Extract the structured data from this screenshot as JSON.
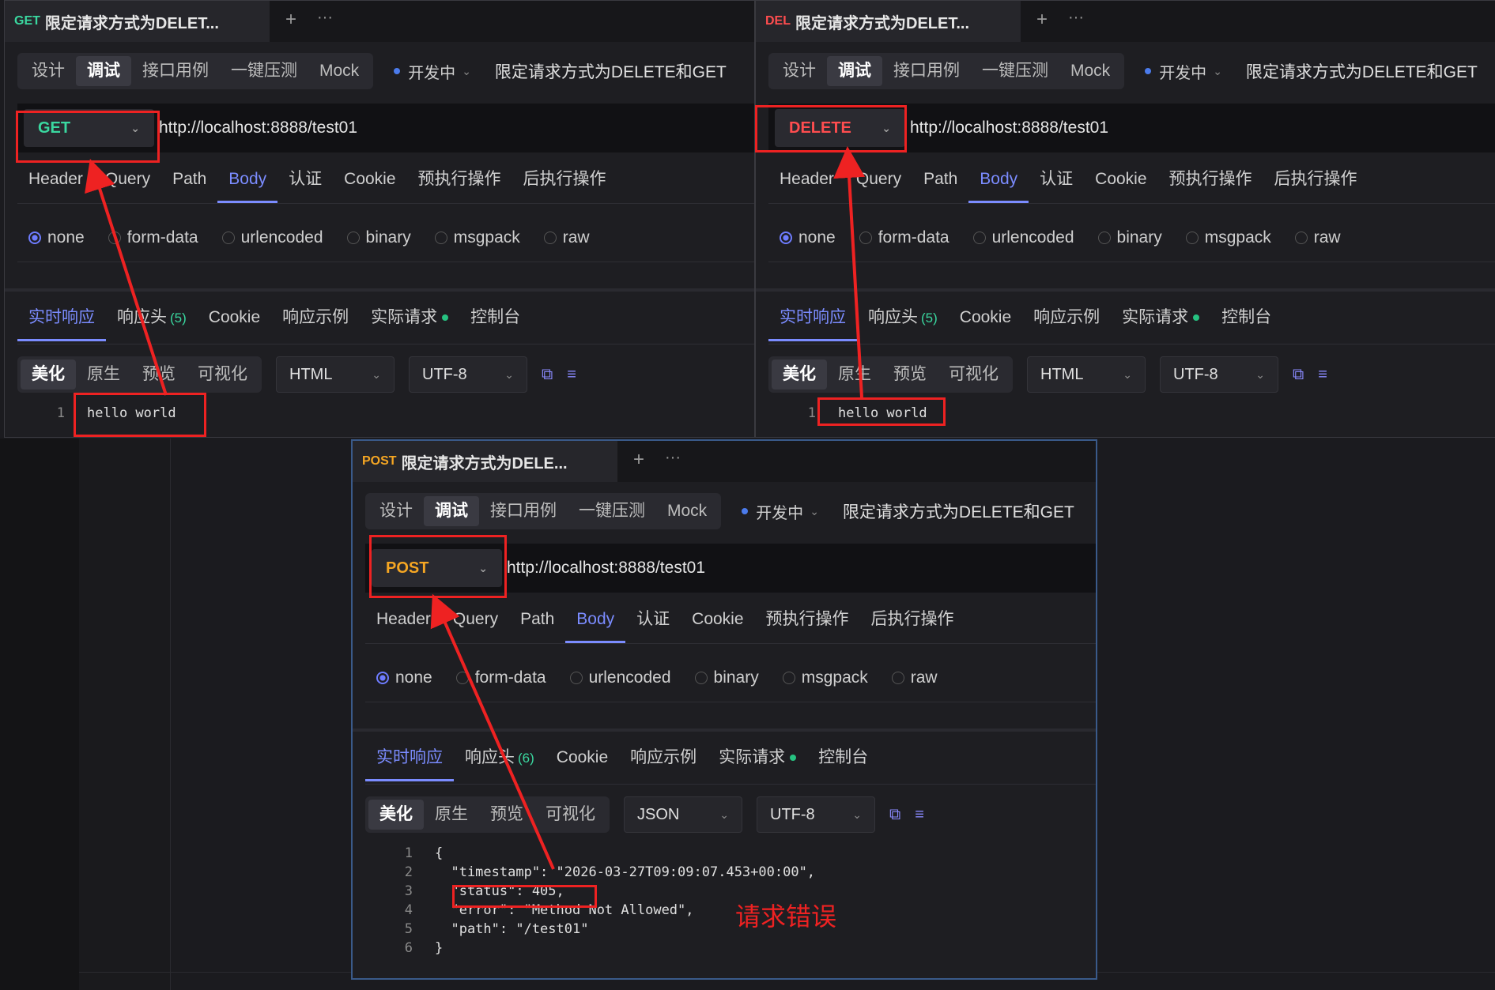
{
  "panels": [
    {
      "tab": {
        "method_tag": "GET",
        "method_color": "#3ad8a0",
        "title": "限定请求方式为DELET..."
      },
      "modes": [
        "设计",
        "调试",
        "接口用例",
        "一键压测",
        "Mock"
      ],
      "active_mode": "调试",
      "status": "开发中",
      "description": "限定请求方式为DELETE和GET",
      "method": "GET",
      "method_color": "#3ad8a0",
      "url": "http://localhost:8888/test01",
      "request_tabs": [
        "Header",
        "Query",
        "Path",
        "Body",
        "认证",
        "Cookie",
        "预执行操作",
        "后执行操作"
      ],
      "active_request_tab": "Body",
      "body_types": [
        "none",
        "form-data",
        "urlencoded",
        "binary",
        "msgpack",
        "raw"
      ],
      "selected_body_type": "none",
      "response_tabs": [
        "实时响应",
        "响应头",
        "Cookie",
        "响应示例",
        "实际请求",
        "控制台"
      ],
      "response_header_count": "(5)",
      "formats": [
        "美化",
        "原生",
        "预览",
        "可视化"
      ],
      "active_format": "美化",
      "content_type": "HTML",
      "encoding": "UTF-8",
      "code_lines": [
        {
          "no": "1",
          "text": "hello world"
        }
      ]
    },
    {
      "tab": {
        "method_tag": "DEL",
        "method_color": "#ff4d4f",
        "title": "限定请求方式为DELET..."
      },
      "modes": [
        "设计",
        "调试",
        "接口用例",
        "一键压测",
        "Mock"
      ],
      "active_mode": "调试",
      "status": "开发中",
      "description": "限定请求方式为DELETE和GET",
      "method": "DELETE",
      "method_color": "#ff4d4f",
      "url": "http://localhost:8888/test01",
      "request_tabs": [
        "Header",
        "Query",
        "Path",
        "Body",
        "认证",
        "Cookie",
        "预执行操作",
        "后执行操作"
      ],
      "active_request_tab": "Body",
      "body_types": [
        "none",
        "form-data",
        "urlencoded",
        "binary",
        "msgpack",
        "raw"
      ],
      "selected_body_type": "none",
      "response_tabs": [
        "实时响应",
        "响应头",
        "Cookie",
        "响应示例",
        "实际请求",
        "控制台"
      ],
      "response_header_count": "(5)",
      "formats": [
        "美化",
        "原生",
        "预览",
        "可视化"
      ],
      "active_format": "美化",
      "content_type": "HTML",
      "encoding": "UTF-8",
      "code_lines": [
        {
          "no": "1",
          "text": "hello world"
        }
      ]
    },
    {
      "tab": {
        "method_tag": "POST",
        "method_color": "#f5a623",
        "title": "限定请求方式为DELE..."
      },
      "modes": [
        "设计",
        "调试",
        "接口用例",
        "一键压测",
        "Mock"
      ],
      "active_mode": "调试",
      "status": "开发中",
      "description": "限定请求方式为DELETE和GET",
      "method": "POST",
      "method_color": "#f5a623",
      "url": "http://localhost:8888/test01",
      "request_tabs": [
        "Header",
        "Query",
        "Path",
        "Body",
        "认证",
        "Cookie",
        "预执行操作",
        "后执行操作"
      ],
      "active_request_tab": "Body",
      "body_types": [
        "none",
        "form-data",
        "urlencoded",
        "binary",
        "msgpack",
        "raw"
      ],
      "selected_body_type": "none",
      "response_tabs": [
        "实时响应",
        "响应头",
        "Cookie",
        "响应示例",
        "实际请求",
        "控制台"
      ],
      "response_header_count": "(6)",
      "formats": [
        "美化",
        "原生",
        "预览",
        "可视化"
      ],
      "active_format": "美化",
      "content_type": "JSON",
      "encoding": "UTF-8",
      "code_lines": [
        {
          "no": "1",
          "text": "{"
        },
        {
          "no": "2",
          "text": "  \"timestamp\": \"2026-03-27T09:09:07.453+00:00\","
        },
        {
          "no": "3",
          "text": "  \"status\": 405,"
        },
        {
          "no": "4",
          "text": "  \"error\": \"Method Not Allowed\","
        },
        {
          "no": "5",
          "text": "  \"path\": \"/test01\""
        },
        {
          "no": "6",
          "text": "}"
        }
      ]
    }
  ],
  "annotation": {
    "text": "请求错误",
    "color": "#ee2222"
  },
  "icons": {
    "plus": "plus-icon",
    "more": "more-icon",
    "copy": "copy-icon",
    "wrap": "wrap-icon",
    "chevron": "chevron-down-icon"
  }
}
